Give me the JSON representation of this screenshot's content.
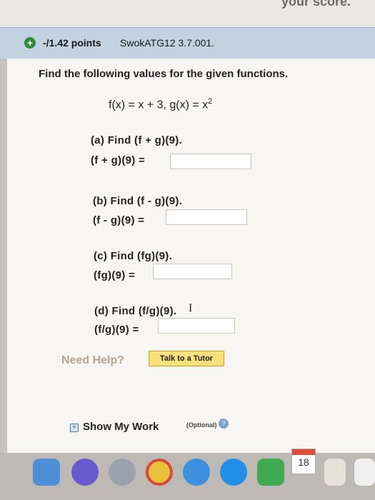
{
  "top": {
    "score_text": "your score."
  },
  "header": {
    "points": "-/1.42 points",
    "question_id": "SwokATG12 3.7.001."
  },
  "question": {
    "prompt": "Find the following values for the given functions.",
    "functions": {
      "f": "f(x) = x + 3",
      "g_base": "g(x) = x",
      "g_exp": "2"
    },
    "parts": [
      {
        "label": "(a) Find (f + g)(9).",
        "answer_label": "(f + g)(9) =",
        "answer_value": ""
      },
      {
        "label": "(b) Find (f - g)(9).",
        "answer_label": "(f - g)(9) =",
        "answer_value": ""
      },
      {
        "label": "(c) Find (fg)(9).",
        "answer_label": "(fg)(9) =",
        "answer_value": ""
      },
      {
        "label": "(d) Find (f/g)(9).",
        "answer_label": "(f/g)(9) =",
        "answer_value": ""
      }
    ]
  },
  "help": {
    "need_help": "Need Help?",
    "tutor_button": "Talk to a Tutor"
  },
  "show_work": {
    "label": "Show My Work",
    "optional": "(Optional)"
  },
  "dock": {
    "calendar_day": "18"
  },
  "colors": {
    "header_bg": "#c3d2e0",
    "accent_red": "#c0392b",
    "tutor_bg": "#f8e17a"
  }
}
